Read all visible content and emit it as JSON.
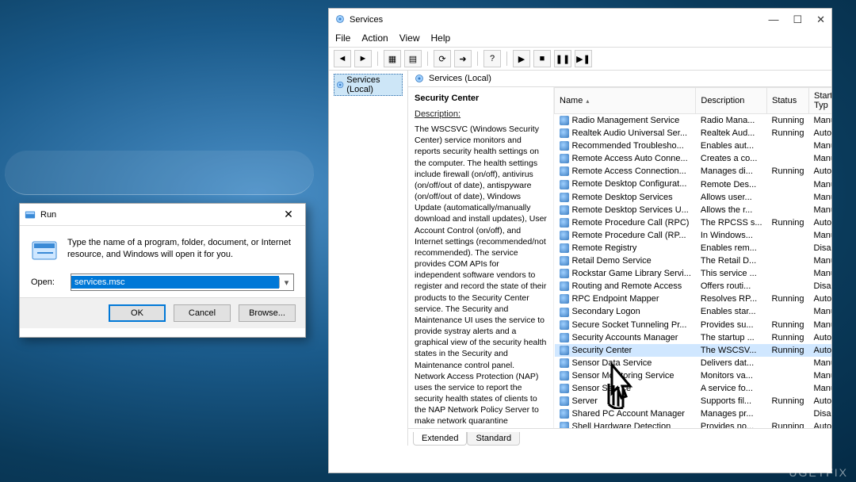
{
  "run": {
    "title": "Run",
    "instruction": "Type the name of a program, folder, document, or Internet resource, and Windows will open it for you.",
    "open_label": "Open:",
    "input_value": "services.msc",
    "buttons": {
      "ok": "OK",
      "cancel": "Cancel",
      "browse": "Browse..."
    }
  },
  "services": {
    "title": "Services",
    "menu": [
      "File",
      "Action",
      "View",
      "Help"
    ],
    "left_node": "Services (Local)",
    "right_header": "Services (Local)",
    "detail": {
      "name": "Security Center",
      "desc_label": "Description:",
      "description": "The WSCSVC (Windows Security Center) service monitors and reports security health settings on the computer.  The health settings include firewall (on/off), antivirus (on/off/out of date), antispyware (on/off/out of date), Windows Update (automatically/manually download and install updates), User Account Control (on/off), and Internet settings (recommended/not recommended). The service provides COM APIs for independent software vendors to register and record the state of their products to the Security Center service.  The Security and Maintenance UI uses the service to provide systray alerts and a graphical view of the security health states in the Security and Maintenance control panel.  Network Access Protection (NAP) uses the service to report the security health states of clients to the NAP Network Policy Server to make network quarantine decisions.  The service also has a public API that allows external consumers to programmatically retrieve the aggregated security health state of"
    },
    "columns": {
      "name": "Name",
      "description": "Description",
      "status": "Status",
      "startup": "Startup Typ"
    },
    "tabs": {
      "extended": "Extended",
      "standard": "Standard"
    },
    "rows": [
      {
        "name": "Radio Management Service",
        "desc": "Radio Mana...",
        "status": "Running",
        "startup": "Manual"
      },
      {
        "name": "Realtek Audio Universal Ser...",
        "desc": "Realtek Aud...",
        "status": "Running",
        "startup": "Automatic"
      },
      {
        "name": "Recommended Troublesho...",
        "desc": "Enables aut...",
        "status": "",
        "startup": "Manual"
      },
      {
        "name": "Remote Access Auto Conne...",
        "desc": "Creates a co...",
        "status": "",
        "startup": "Manual"
      },
      {
        "name": "Remote Access Connection...",
        "desc": "Manages di...",
        "status": "Running",
        "startup": "Automatic"
      },
      {
        "name": "Remote Desktop Configurat...",
        "desc": "Remote Des...",
        "status": "",
        "startup": "Manual"
      },
      {
        "name": "Remote Desktop Services",
        "desc": "Allows user...",
        "status": "",
        "startup": "Manual"
      },
      {
        "name": "Remote Desktop Services U...",
        "desc": "Allows the r...",
        "status": "",
        "startup": "Manual"
      },
      {
        "name": "Remote Procedure Call (RPC)",
        "desc": "The RPCSS s...",
        "status": "Running",
        "startup": "Automatic"
      },
      {
        "name": "Remote Procedure Call (RP...",
        "desc": "In Windows...",
        "status": "",
        "startup": "Manual"
      },
      {
        "name": "Remote Registry",
        "desc": "Enables rem...",
        "status": "",
        "startup": "Disabled"
      },
      {
        "name": "Retail Demo Service",
        "desc": "The Retail D...",
        "status": "",
        "startup": "Manual"
      },
      {
        "name": "Rockstar Game Library Servi...",
        "desc": "This service ...",
        "status": "",
        "startup": "Manual"
      },
      {
        "name": "Routing and Remote Access",
        "desc": "Offers routi...",
        "status": "",
        "startup": "Disabled"
      },
      {
        "name": "RPC Endpoint Mapper",
        "desc": "Resolves RP...",
        "status": "Running",
        "startup": "Automatic"
      },
      {
        "name": "Secondary Logon",
        "desc": "Enables star...",
        "status": "",
        "startup": "Manual"
      },
      {
        "name": "Secure Socket Tunneling Pr...",
        "desc": "Provides su...",
        "status": "Running",
        "startup": "Manual"
      },
      {
        "name": "Security Accounts Manager",
        "desc": "The startup ...",
        "status": "Running",
        "startup": "Automatic"
      },
      {
        "name": "Security Center",
        "desc": "The WSCSV...",
        "status": "Running",
        "startup": "Automatic",
        "selected": true
      },
      {
        "name": "Sensor Data Service",
        "desc": "Delivers dat...",
        "status": "",
        "startup": "Manual (Tri"
      },
      {
        "name": "Sensor Monitoring Service",
        "desc": "Monitors va...",
        "status": "",
        "startup": "Manual (Tri"
      },
      {
        "name": "Sensor Service",
        "desc": "A service fo...",
        "status": "",
        "startup": "Manual (Tri"
      },
      {
        "name": "Server",
        "desc": "Supports fil...",
        "status": "Running",
        "startup": "Automatic"
      },
      {
        "name": "Shared PC Account Manager",
        "desc": "Manages pr...",
        "status": "",
        "startup": "Disabled"
      },
      {
        "name": "Shell Hardware Detection",
        "desc": "Provides no...",
        "status": "Running",
        "startup": "Automatic"
      }
    ]
  },
  "watermark": "UGETFIX"
}
